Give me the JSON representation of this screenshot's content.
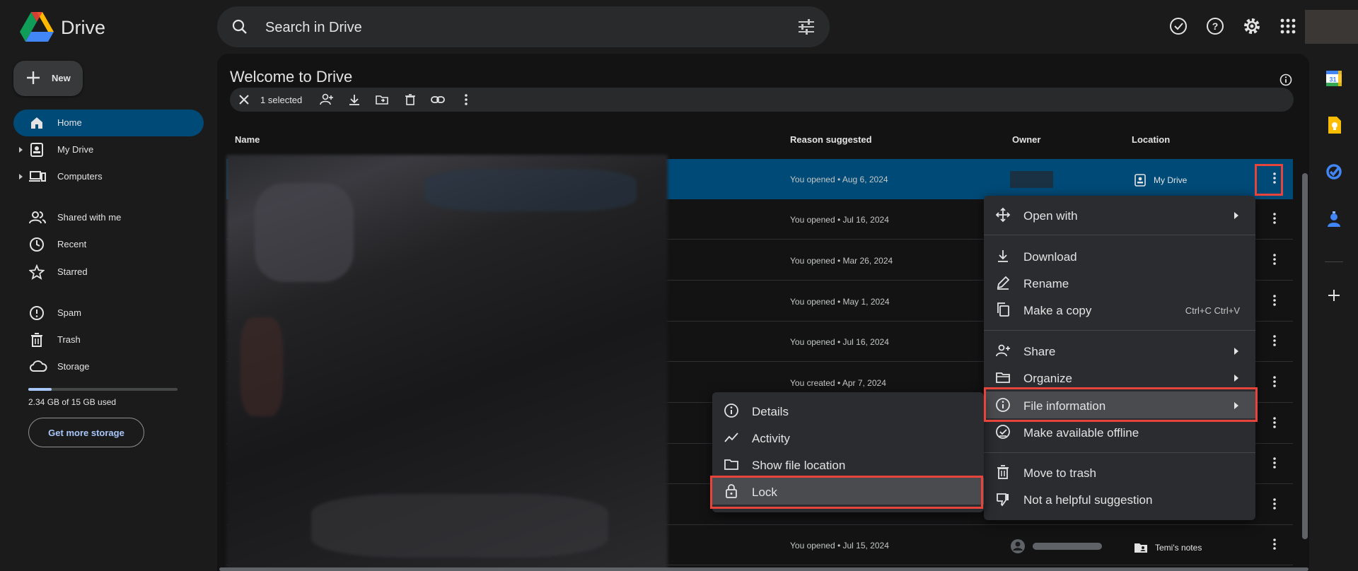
{
  "app": {
    "brand": "Drive"
  },
  "search": {
    "placeholder": "Search in Drive"
  },
  "sidebar": {
    "new_label": "New",
    "items": [
      {
        "label": "Home",
        "icon": "home-icon",
        "active": true
      },
      {
        "label": "My Drive",
        "icon": "my-drive-icon"
      },
      {
        "label": "Computers",
        "icon": "computers-icon"
      },
      {
        "label": "Shared with me",
        "icon": "shared-icon"
      },
      {
        "label": "Recent",
        "icon": "clock-icon"
      },
      {
        "label": "Starred",
        "icon": "star-icon"
      },
      {
        "label": "Spam",
        "icon": "spam-icon"
      },
      {
        "label": "Trash",
        "icon": "trash-icon"
      },
      {
        "label": "Storage",
        "icon": "cloud-icon"
      }
    ],
    "storage_used_fraction": 0.156,
    "storage_text": "2.34 GB of 15 GB used",
    "get_storage": "Get more storage"
  },
  "main": {
    "title": "Welcome to Drive",
    "selection": {
      "count_label": "1 selected"
    },
    "columns": {
      "name": "Name",
      "reason": "Reason suggested",
      "owner": "Owner",
      "location": "Location"
    },
    "rows": [
      {
        "reason": "You opened • Aug 6, 2024",
        "location": "My Drive"
      },
      {
        "reason": "You opened • Jul 16, 2024"
      },
      {
        "reason": "You opened • Mar 26, 2024"
      },
      {
        "reason": "You opened • May 1, 2024"
      },
      {
        "reason": "You opened • Jul 16, 2024"
      },
      {
        "reason": "You created • Apr 7, 2024"
      },
      {
        "reason": ""
      },
      {
        "reason": ""
      },
      {
        "reason": ""
      },
      {
        "reason": "You opened • Jul 15, 2024",
        "location": "Temi's notes"
      }
    ]
  },
  "context_menu": {
    "open_with": "Open with",
    "download": "Download",
    "rename": "Rename",
    "make_copy": "Make a copy",
    "make_copy_shortcut": "Ctrl+C Ctrl+V",
    "share": "Share",
    "organize": "Organize",
    "file_info": "File information",
    "offline": "Make available offline",
    "trash": "Move to trash",
    "not_helpful": "Not a helpful suggestion"
  },
  "submenu": {
    "details": "Details",
    "activity": "Activity",
    "show_location": "Show file location",
    "lock": "Lock"
  },
  "colors": {
    "accent": "#004a77",
    "highlight_box": "#e7453c",
    "link": "#a8c7fa"
  }
}
